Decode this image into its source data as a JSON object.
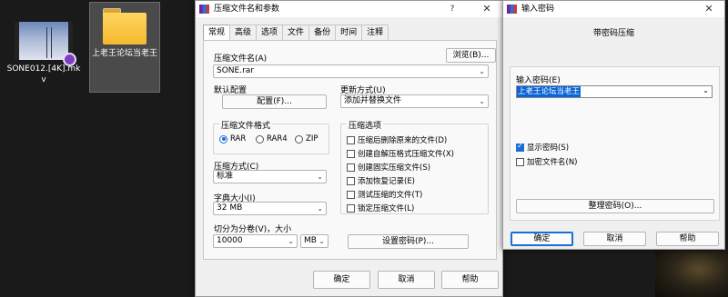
{
  "desktop": {
    "video_file": {
      "name": "SONE012.[4K].mkv",
      "icon": "video-thumbnail-icon"
    },
    "folder": {
      "name": "上老王论坛当老王",
      "icon": "folder-icon"
    }
  },
  "main_dialog": {
    "title": "压缩文件名和参数",
    "help": "?",
    "close": "✕",
    "tabs": [
      "常规",
      "高级",
      "选项",
      "文件",
      "备份",
      "时间",
      "注释"
    ],
    "archive_name_label": "压缩文件名(A)",
    "browse_button": "浏览(B)...",
    "archive_name_value": "SONE.rar",
    "default_profile_label": "默认配置",
    "profiles_button": "配置(F)...",
    "update_mode_label": "更新方式(U)",
    "update_mode_value": "添加并替换文件",
    "format_group": "压缩文件格式",
    "formats": [
      "RAR",
      "RAR4",
      "ZIP"
    ],
    "format_selected": "RAR",
    "options_group": "压缩选项",
    "options": [
      {
        "label": "压缩后删除原来的文件(D)",
        "checked": false
      },
      {
        "label": "创建自解压格式压缩文件(X)",
        "checked": false
      },
      {
        "label": "创建固实压缩文件(S)",
        "checked": false
      },
      {
        "label": "添加恢复记录(E)",
        "checked": false
      },
      {
        "label": "测试压缩的文件(T)",
        "checked": false
      },
      {
        "label": "锁定压缩文件(L)",
        "checked": false
      }
    ],
    "method_label": "压缩方式(C)",
    "method_value": "标准",
    "dict_label": "字典大小(I)",
    "dict_value": "32 MB",
    "split_label": "切分为分卷(V)，大小",
    "split_value": "10000",
    "split_unit": "MB",
    "set_password_button": "设置密码(P)...",
    "ok": "确定",
    "cancel": "取消",
    "help_button": "帮助"
  },
  "password_dialog": {
    "title": "输入密码",
    "close": "✕",
    "heading": "带密码压缩",
    "enter_label": "输入密码(E)",
    "password_value": "上老王论坛当老王",
    "show_password": {
      "label": "显示密码(S)",
      "checked": true
    },
    "encrypt_names": {
      "label": "加密文件名(N)",
      "checked": false
    },
    "organize_button": "整理密码(O)...",
    "ok": "确定",
    "cancel": "取消",
    "help_button": "帮助"
  },
  "colors": {
    "accent": "#1a6fd6",
    "selection": "#0a64d8",
    "desktop": "#1a1a1a"
  }
}
